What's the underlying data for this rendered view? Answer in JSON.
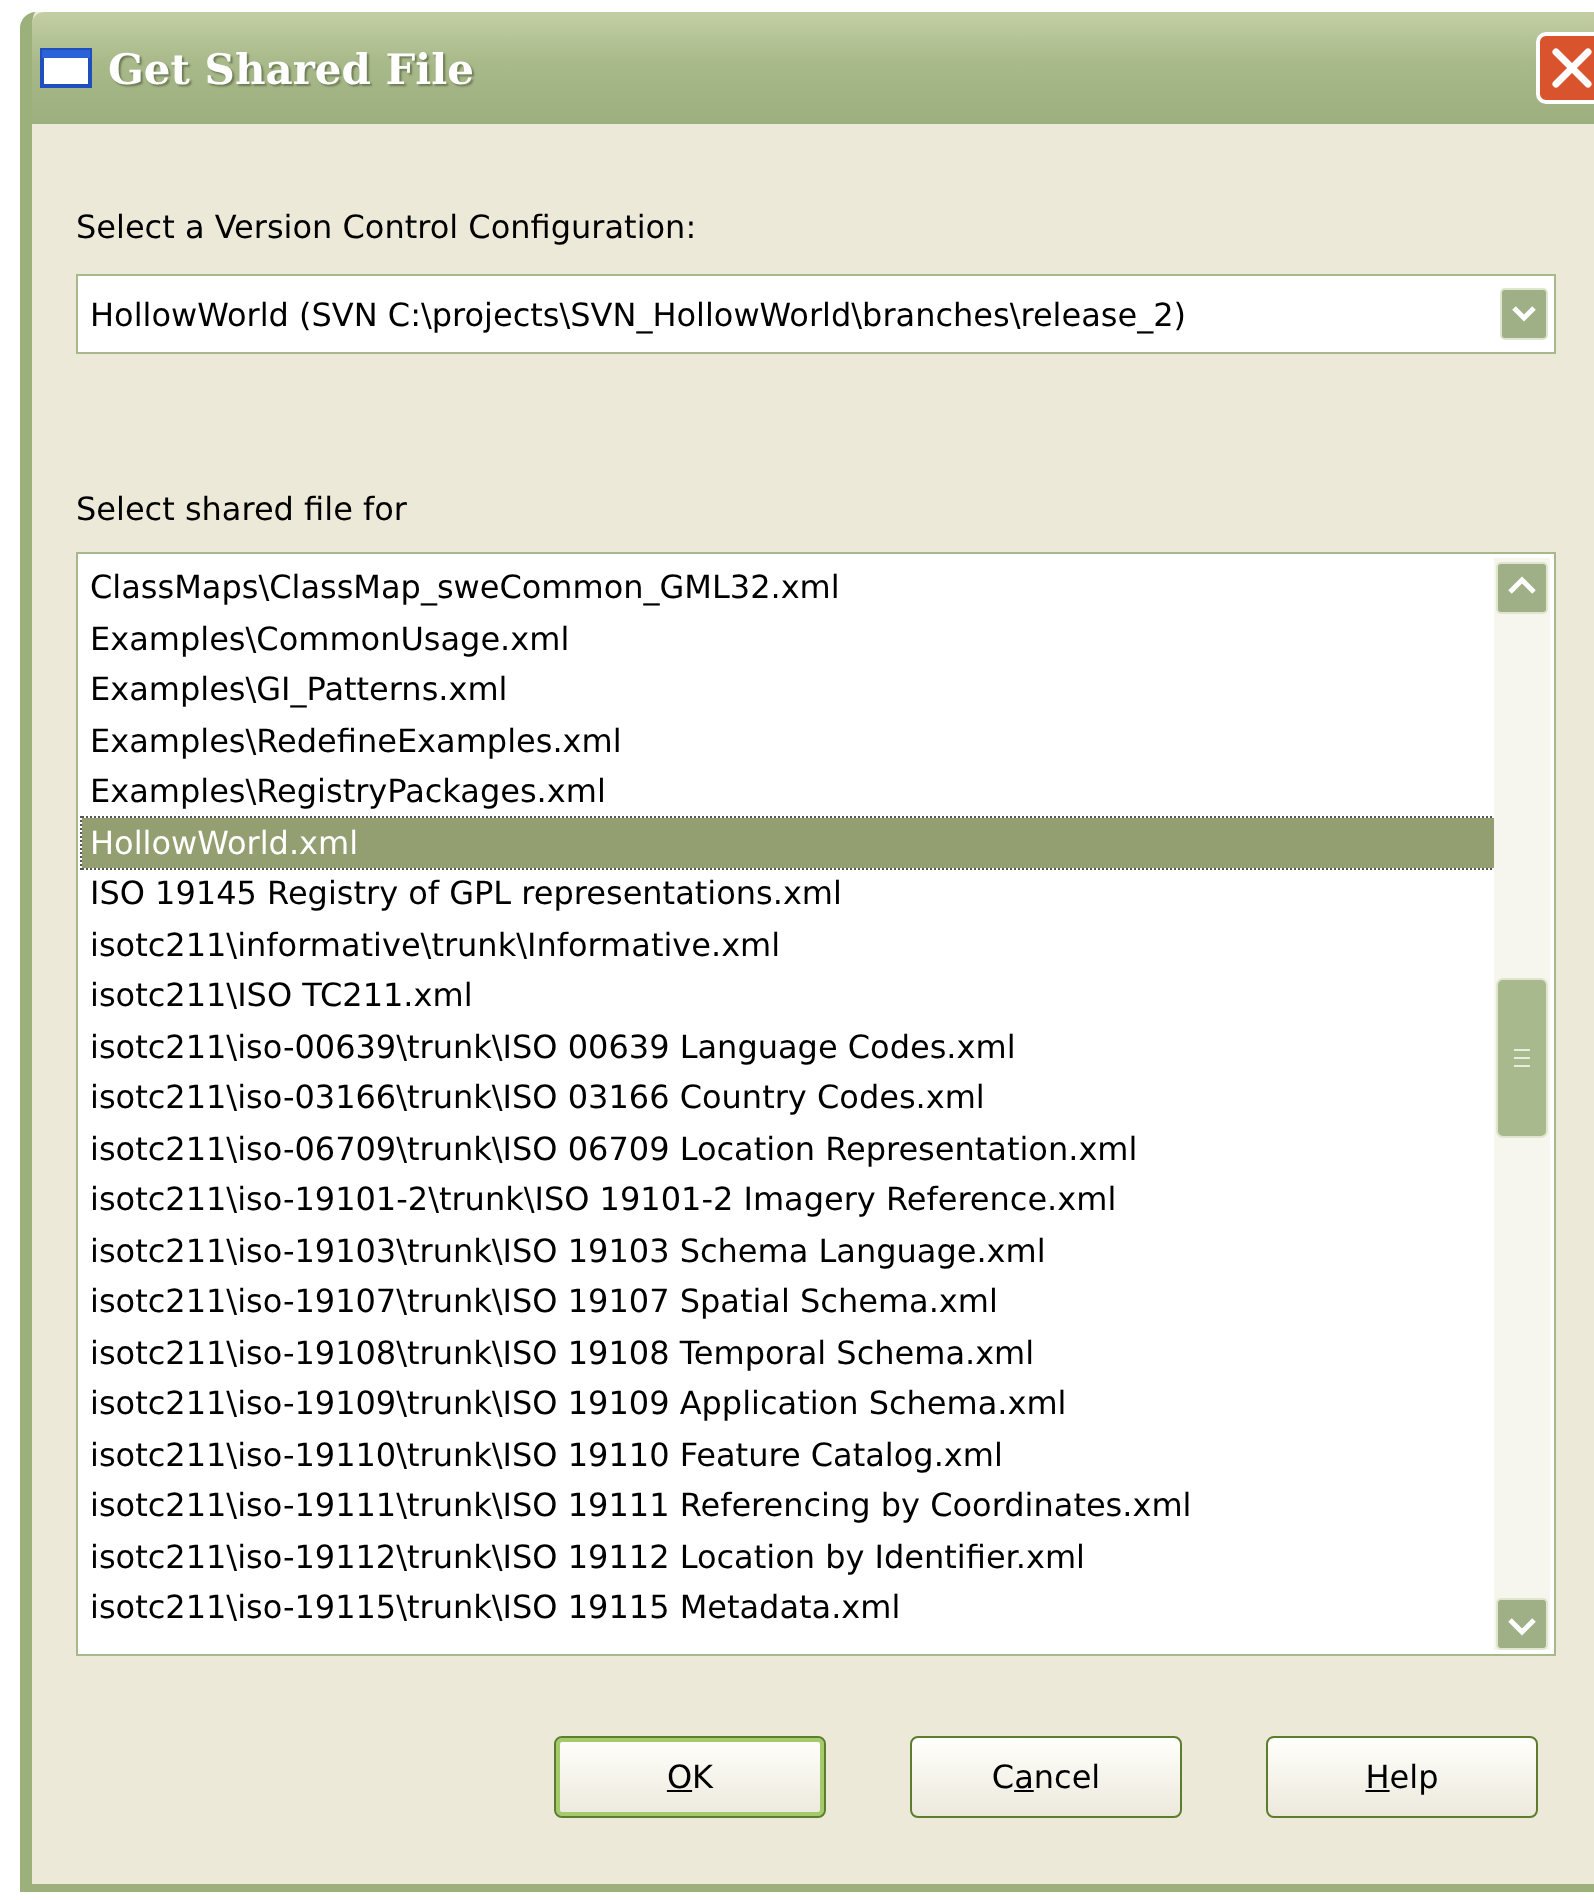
{
  "window": {
    "title": "Get Shared File"
  },
  "configuration": {
    "label": "Select a Version Control Configuration:",
    "value": "HollowWorld (SVN C:\\projects\\SVN_HollowWorld\\branches\\release_2)"
  },
  "shared_files": {
    "label": "Select shared file for",
    "items": [
      {
        "name": "ClassMaps\\ClassMap_sweCommon_GML32.xml",
        "selected": false
      },
      {
        "name": "Examples\\CommonUsage.xml",
        "selected": false
      },
      {
        "name": "Examples\\GI_Patterns.xml",
        "selected": false
      },
      {
        "name": "Examples\\RedefineExamples.xml",
        "selected": false
      },
      {
        "name": "Examples\\RegistryPackages.xml",
        "selected": false
      },
      {
        "name": "HollowWorld.xml",
        "selected": true
      },
      {
        "name": "ISO 19145 Registry of GPL representations.xml",
        "selected": false
      },
      {
        "name": "isotc211\\informative\\trunk\\Informative.xml",
        "selected": false
      },
      {
        "name": "isotc211\\ISO TC211.xml",
        "selected": false
      },
      {
        "name": "isotc211\\iso-00639\\trunk\\ISO 00639 Language Codes.xml",
        "selected": false
      },
      {
        "name": "isotc211\\iso-03166\\trunk\\ISO 03166 Country Codes.xml",
        "selected": false
      },
      {
        "name": "isotc211\\iso-06709\\trunk\\ISO 06709 Location Representation.xml",
        "selected": false
      },
      {
        "name": "isotc211\\iso-19101-2\\trunk\\ISO 19101-2 Imagery Reference.xml",
        "selected": false
      },
      {
        "name": "isotc211\\iso-19103\\trunk\\ISO 19103 Schema Language.xml",
        "selected": false
      },
      {
        "name": "isotc211\\iso-19107\\trunk\\ISO 19107 Spatial Schema.xml",
        "selected": false
      },
      {
        "name": "isotc211\\iso-19108\\trunk\\ISO 19108 Temporal Schema.xml",
        "selected": false
      },
      {
        "name": "isotc211\\iso-19109\\trunk\\ISO 19109 Application Schema.xml",
        "selected": false
      },
      {
        "name": "isotc211\\iso-19110\\trunk\\ISO 19110 Feature Catalog.xml",
        "selected": false
      },
      {
        "name": "isotc211\\iso-19111\\trunk\\ISO 19111 Referencing by Coordinates.xml",
        "selected": false
      },
      {
        "name": "isotc211\\iso-19112\\trunk\\ISO 19112 Location by Identifier.xml",
        "selected": false
      },
      {
        "name": "isotc211\\iso-19115\\trunk\\ISO 19115 Metadata.xml",
        "selected": false
      }
    ]
  },
  "buttons": [
    {
      "access_key": "O",
      "label_post": "K",
      "default": true
    },
    {
      "label_pre": "C",
      "access_key": "a",
      "label_post": "ncel",
      "default": false
    },
    {
      "access_key": "H",
      "label_post": "elp",
      "default": false
    }
  ]
}
